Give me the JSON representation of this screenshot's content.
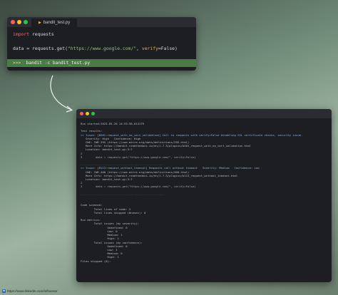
{
  "colors": {
    "red_dot": "#ff5f57",
    "yellow_dot": "#febc2e",
    "green_dot": "#28c840",
    "command_bar": "#4a7a45",
    "arrow": "#f2f2f2"
  },
  "editor": {
    "tab_label": "bandit_test.py",
    "code_lines": [
      {
        "kw": "import",
        "rest": " requests"
      },
      {
        "prefix": "data = requests.get(",
        "str": "\"https://www.google.com/\"",
        "mid": ", ",
        "kwarg": "verify",
        "suffix": "=False)"
      }
    ],
    "command": {
      "prompt": ">>>",
      "text": "bandit -c bandit_test.py"
    }
  },
  "terminal": {
    "lines": [
      "Run started:2023-05-28 14:53:58.614179",
      "",
      "Test results:",
      ">> Issue: [B501:request_with_no_cert_validation] Call to requests with verify=False disabling SSL certificate checks, security issue.",
      "   Severity: High   Confidence: High",
      "   CWE: CWE-295 (https://cwe.mitre.org/data/definitions/295.html)",
      "   More Info: https://bandit.readthedocs.io/en/1.7.5/plugins/b501_request_with_no_cert_validation.html",
      "   Location: bandit_test.py:3:7",
      "2",
      "3        data = requests.get(\"https://www.google.com/\", verify=False)",
      "",
      "--------------------------------------------------",
      ">> Issue: [B113:request_without_timeout] Requests call without timeout   Severity: Medium   Confidence: Low",
      "   CWE: CWE-400 (https://cwe.mitre.org/data/definitions/400.html)",
      "   More Info: https://bandit.readthedocs.io/en/1.7.5/plugins/b113_request_without_timeout.html",
      "   Location: bandit_test.py:3:7",
      "2",
      "3        data = requests.get(\"https://www.google.com/\", verify=False)",
      "",
      "--------------------------------------------------",
      "",
      "",
      "Code scanned:",
      "        Total lines of code: 2",
      "        Total lines skipped (#nosec): 0",
      "",
      "Run metrics:",
      "        Total issues (by severity):",
      "                Undefined: 0",
      "                Low: 0",
      "                Medium: 1",
      "                High: 1",
      "        Total issues (by confidence):",
      "                Undefined: 0",
      "                Low: 1",
      "                Medium: 0",
      "                High: 1",
      "Files skipped (0):"
    ]
  },
  "footer": {
    "url": "https://www.linkedin.com/in/hansar"
  }
}
